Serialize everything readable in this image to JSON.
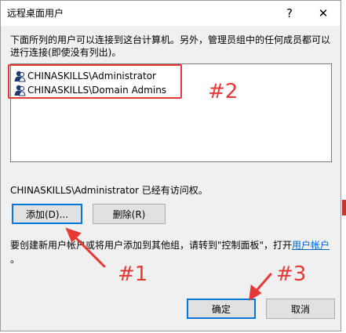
{
  "dialog": {
    "title": "远程桌面用户",
    "help_icon": "?",
    "close_icon": "✕",
    "intro": "下面所列的用户可以连接到这台计算机。另外，管理员组中的任何成员都可以\n进行连接(即使没有列出)。",
    "users": [
      "CHINASKILLS\\Administrator",
      "CHINASKILLS\\Domain Admins"
    ],
    "access_text": "CHINASKILLS\\Administrator 已经有访问权。",
    "add_label": "添加(D)...",
    "remove_label": "删除(R)",
    "note_prefix": "要创建新用户帐户或将用户添加到其他组，请转到\"控制面板\"，打开",
    "note_link": "用户帐户",
    "note_suffix": "。",
    "ok_label": "确定",
    "cancel_label": "取消"
  },
  "annotations": {
    "a1": "#1",
    "a2": "#2",
    "a3": "#3",
    "color": "#e53935"
  },
  "colors": {
    "focus": "#0078d7",
    "link": "#0066cc"
  }
}
